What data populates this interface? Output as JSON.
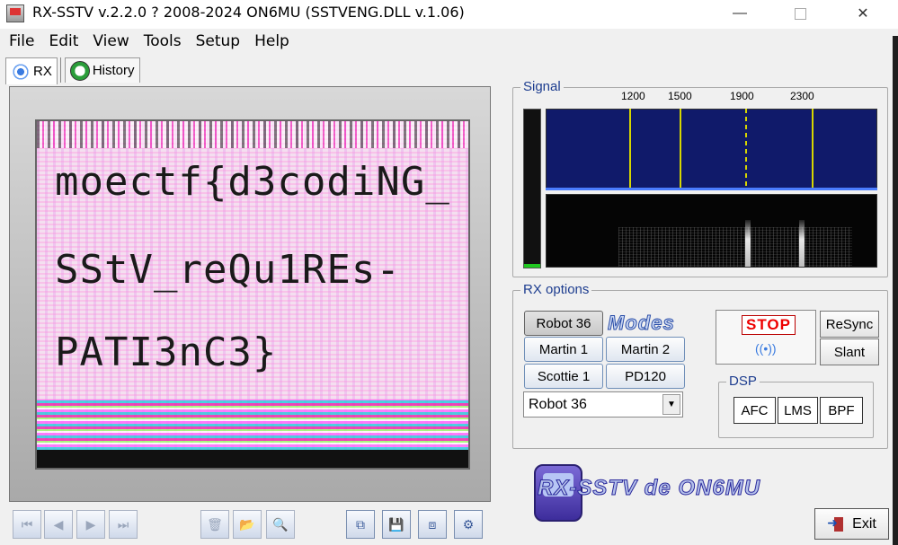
{
  "window": {
    "title": "RX-SSTV v.2.2.0 ? 2008-2024 ON6MU (SSTVENG.DLL v.1.06)",
    "min_glyph": "—",
    "close_glyph": "✕"
  },
  "menu": [
    "File",
    "Edit",
    "View",
    "Tools",
    "Setup",
    "Help"
  ],
  "tabs": {
    "rx": "RX",
    "history": "History"
  },
  "image_text": {
    "line1": "moectf{d3codiNG_",
    "line2": "SStV_reQu1REs-",
    "line3": "PATI3nC3}"
  },
  "nav_buttons": {
    "first": "⏮",
    "prev": "◀",
    "next": "▶",
    "last": "⏭",
    "delete": "🗑",
    "open": "📂",
    "zoom": "🔍",
    "copy": "⧉",
    "save": "💾",
    "save_as": "⧈",
    "settings": "⚙"
  },
  "signal": {
    "label": "Signal",
    "freqs": [
      "1200",
      "1500",
      "1900",
      "2300"
    ],
    "level_fraction": 0.02
  },
  "rx_options": {
    "label": "RX options",
    "modes_logo": "Modes",
    "buttons": {
      "robot36": "Robot 36",
      "martin1": "Martin 1",
      "martin2": "Martin 2",
      "scottie1": "Scottie 1",
      "pd120": "PD120"
    },
    "selected_mode": "Robot 36",
    "stop": "STOP",
    "resync": "ReSync",
    "slant": "Slant"
  },
  "dsp": {
    "label": "DSP",
    "afc": "AFC",
    "lms": "LMS",
    "bpf": "BPF"
  },
  "brand": "RX-SSTV de ON6MU",
  "exit": "Exit",
  "colors": {
    "spectrum_bg": "#101a6a",
    "marker": "#d6d600",
    "stop": "#e00000",
    "group_label": "#1d3d8f"
  }
}
